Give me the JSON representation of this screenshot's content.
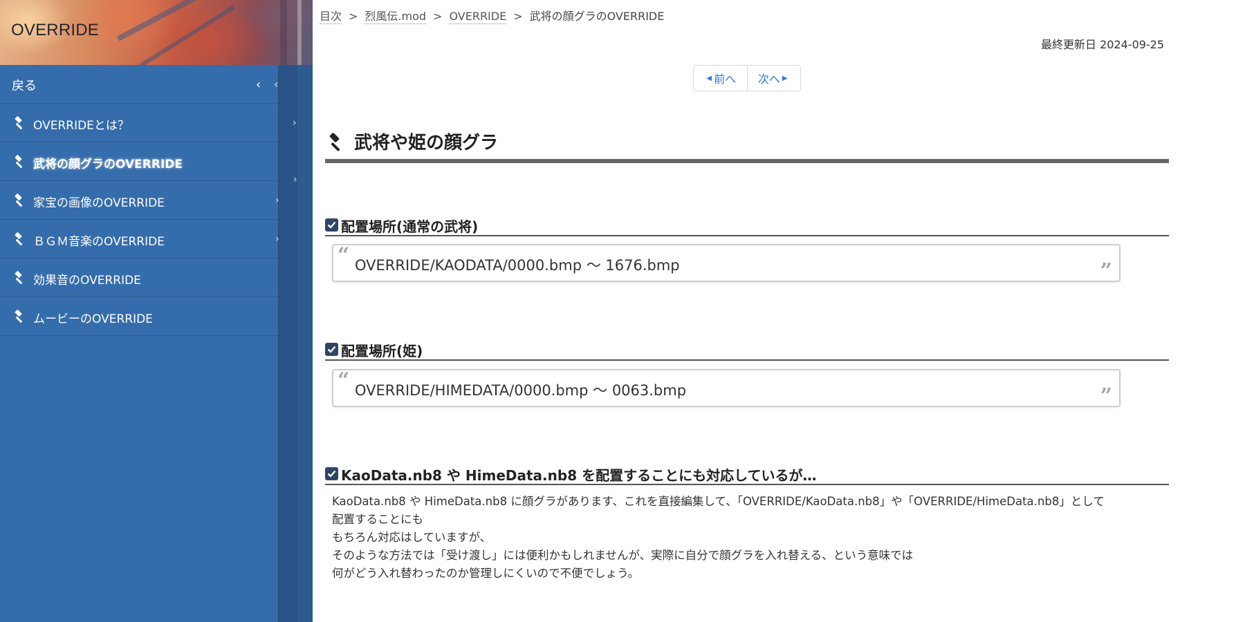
{
  "sidebar": {
    "title": "OVERRIDE",
    "back_label": "戻る",
    "items": [
      {
        "label": "OVERRIDEとは？",
        "active": false,
        "has_children": true
      },
      {
        "label": "武将の顔グラのOVERRIDE",
        "active": true,
        "has_children": false
      },
      {
        "label": "家宝の画像のOVERRIDE",
        "active": false,
        "has_children": true
      },
      {
        "label": "ＢＧＭ音楽のOVERRIDE",
        "active": false,
        "has_children": true
      },
      {
        "label": "効果音のOVERRIDE",
        "active": false,
        "has_children": false
      },
      {
        "label": "ムービーのOVERRIDE",
        "active": false,
        "has_children": false
      }
    ],
    "colors": {
      "background": "#356cab",
      "dark_column": "#2a5487"
    }
  },
  "breadcrumb": {
    "items": [
      "目次",
      "烈風伝.mod",
      "OVERRIDE"
    ],
    "current": "武将の顔グラのOVERRIDE",
    "separator": ">"
  },
  "updated": "最終更新日 2024-09-25",
  "pager": {
    "prev_label": "前へ",
    "next_label": "次へ"
  },
  "main": {
    "heading": "武将や姫の顔グラ",
    "sections": [
      {
        "title": "配置場所(通常の武将)",
        "quote": "OVERRIDE/KAODATA/0000.bmp 〜 1676.bmp"
      },
      {
        "title": "配置場所(姫)",
        "quote": "OVERRIDE/HIMEDATA/0000.bmp 〜 0063.bmp"
      },
      {
        "title": "KaoData.nb8 や HimeData.nb8 を配置することにも対応しているが…",
        "lines": [
          "KaoData.nb8 や HimeData.nb8 に顔グラがあります、これを直接編集して、「OVERRIDE/KaoData.nb8」や「OVERRIDE/HimeData.nb8」として",
          "配置することにも",
          "もちろん対応はしていますが、",
          "そのような方法では「受け渡し」には便利かもしれませんが、実際に自分で顔グラを入れ替える、という意味では",
          "何がどう入れ替わったのか管理しにくいので不便でしょう。"
        ]
      }
    ]
  },
  "icons": {
    "item_icon": "gavel-icon",
    "heading_icon": "gavel-icon",
    "section_icon": "checkbox-checked-icon",
    "quote_open": "quote-open-icon",
    "quote_close": "quote-close-icon"
  }
}
